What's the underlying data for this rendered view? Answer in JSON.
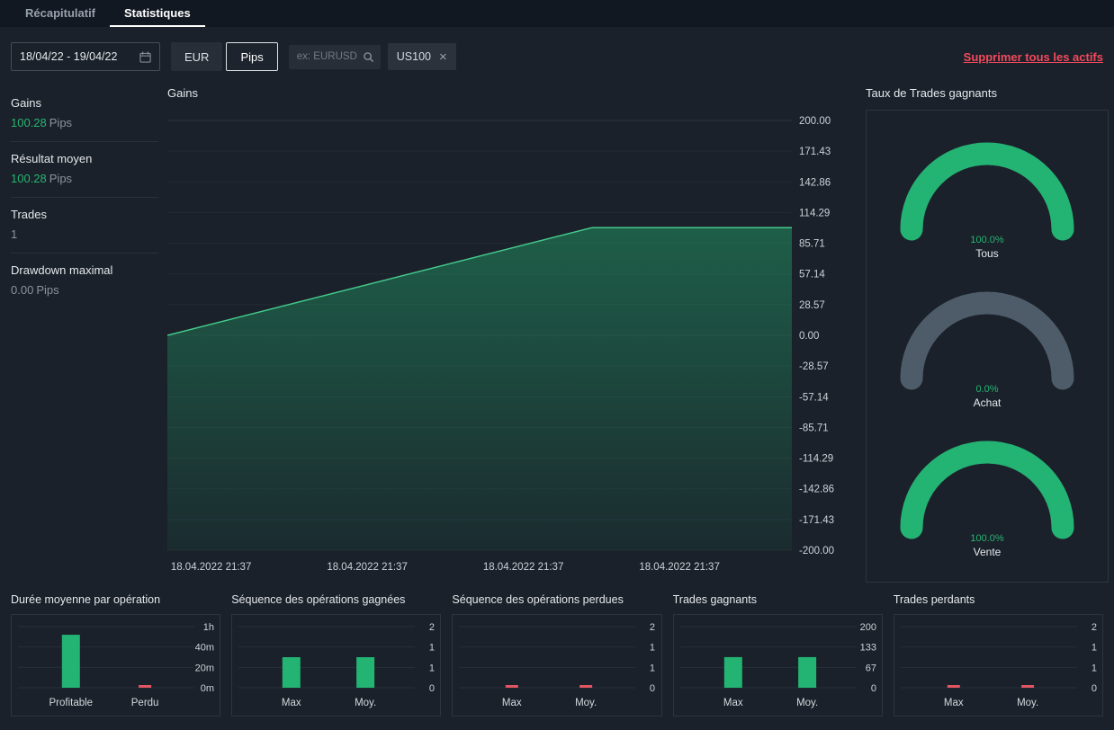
{
  "tabs": {
    "items": [
      {
        "label": "Récapitulatif"
      },
      {
        "label": "Statistiques"
      }
    ]
  },
  "toolbar": {
    "date_range": "18/04/22 - 19/04/22",
    "currency": "EUR",
    "unit": "Pips",
    "search_placeholder": "ex: EURUSD",
    "asset_chip": {
      "label": "US100",
      "remove": "×"
    },
    "delete_all_link": "Supprimer tous les actifs"
  },
  "summary": {
    "items": [
      {
        "label": "Gains",
        "value": "100.28",
        "unit": "Pips",
        "tone": "green"
      },
      {
        "label": "Résultat moyen",
        "value": "100.28",
        "unit": "Pips",
        "tone": "green"
      },
      {
        "label": "Trades",
        "value": "1",
        "unit": "",
        "tone": "muted"
      },
      {
        "label": "Drawdown maximal",
        "value": "0.00",
        "unit": "Pips",
        "tone": "muted"
      }
    ]
  },
  "chart_data": {
    "gains": {
      "type": "area",
      "title": "Gains",
      "ylim": [
        -200,
        200
      ],
      "grid": true,
      "legend": "none",
      "y_ticks": [
        "200.00",
        "171.43",
        "142.86",
        "114.29",
        "85.71",
        "57.14",
        "28.57",
        "0.00",
        "-28.57",
        "-57.14",
        "-85.71",
        "-114.29",
        "-142.86",
        "-171.43",
        "-200.00"
      ],
      "x_ticks": [
        "18.04.2022 21:37",
        "18.04.2022 21:37",
        "18.04.2022 21:37",
        "18.04.2022 21:37"
      ],
      "series": [
        {
          "name": "Gains",
          "color": "#45c98b",
          "points": [
            {
              "x": 0,
              "y": 0
            },
            {
              "x": 0.68,
              "y": 100.28
            },
            {
              "x": 1,
              "y": 100.28
            }
          ]
        }
      ]
    },
    "win_rate": {
      "type": "gauge",
      "title": "Taux de Trades gagnants",
      "items": [
        {
          "label": "Tous",
          "value": 100.0,
          "display": "100.0%"
        },
        {
          "label": "Achat",
          "value": 0.0,
          "display": "0.0%"
        },
        {
          "label": "Vente",
          "value": 100.0,
          "display": "100.0%"
        }
      ]
    },
    "mini_charts": [
      {
        "type": "bar",
        "title": "Durée moyenne par opération",
        "categories": [
          "Profitable",
          "Perdu"
        ],
        "values": [
          52,
          0
        ],
        "colors": [
          "green",
          "red"
        ],
        "ylim": [
          0,
          60
        ],
        "y_tick_labels": [
          "1h",
          "40m",
          "20m",
          "0m"
        ]
      },
      {
        "type": "bar",
        "title": "Séquence des opérations gagnées",
        "categories": [
          "Max",
          "Moy."
        ],
        "values": [
          1,
          1
        ],
        "colors": [
          "green",
          "green"
        ],
        "ylim": [
          0,
          2
        ],
        "y_tick_labels": [
          "2",
          "1",
          "1",
          "0"
        ]
      },
      {
        "type": "bar",
        "title": "Séquence des opérations perdues",
        "categories": [
          "Max",
          "Moy."
        ],
        "values": [
          0,
          0
        ],
        "colors": [
          "red",
          "red"
        ],
        "ylim": [
          0,
          2
        ],
        "y_tick_labels": [
          "2",
          "1",
          "1",
          "0"
        ]
      },
      {
        "type": "bar",
        "title": "Trades gagnants",
        "categories": [
          "Max",
          "Moy."
        ],
        "values": [
          100.28,
          100.28
        ],
        "colors": [
          "green",
          "green"
        ],
        "ylim": [
          0,
          200
        ],
        "y_tick_labels": [
          "200",
          "133",
          "67",
          "0"
        ]
      },
      {
        "type": "bar",
        "title": "Trades perdants",
        "categories": [
          "Max",
          "Moy."
        ],
        "values": [
          0,
          0
        ],
        "colors": [
          "red",
          "red"
        ],
        "ylim": [
          0,
          2
        ],
        "y_tick_labels": [
          "2",
          "1",
          "1",
          "0"
        ]
      }
    ]
  },
  "colors": {
    "green": "#23b373",
    "red": "#e25563",
    "line": "#45c98b",
    "gauge_track": "#4e5c6a",
    "link_red": "#f24a5c"
  }
}
